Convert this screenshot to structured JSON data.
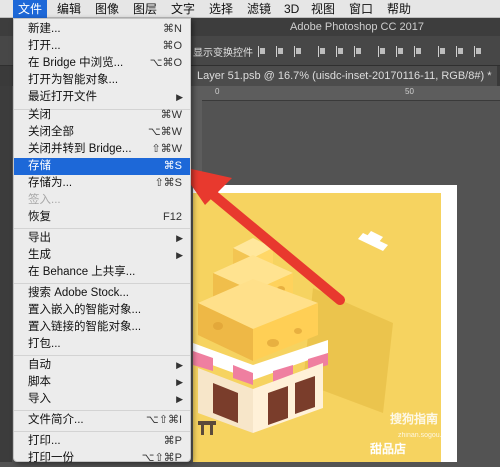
{
  "menubar": {
    "items": [
      "文件",
      "编辑",
      "图像",
      "图层",
      "文字",
      "选择",
      "滤镜",
      "3D",
      "视图",
      "窗口",
      "帮助"
    ]
  },
  "app": {
    "title": "Adobe Photoshop CC 2017"
  },
  "options_bar": {
    "label": "显示变换控件"
  },
  "document_tab": {
    "title": "Layer 51.psb @ 16.7% (uisdc-inset-20170116-11, RGB/8#) *"
  },
  "ruler": {
    "ticks": [
      "0",
      "50"
    ]
  },
  "file_menu": {
    "items": [
      {
        "label": "新建...",
        "shortcut": "⌘N"
      },
      {
        "label": "打开...",
        "shortcut": "⌘O"
      },
      {
        "label": "在 Bridge 中浏览...",
        "shortcut": "⌥⌘O"
      },
      {
        "label": "打开为智能对象..."
      },
      {
        "label": "最近打开文件",
        "submenu": true
      },
      {
        "label": "关闭",
        "shortcut": "⌘W"
      },
      {
        "label": "关闭全部",
        "shortcut": "⌥⌘W"
      },
      {
        "label": "关闭并转到 Bridge...",
        "shortcut": "⇧⌘W"
      },
      {
        "label": "存储",
        "shortcut": "⌘S",
        "highlighted": true
      },
      {
        "label": "存储为...",
        "shortcut": "⇧⌘S"
      },
      {
        "label": "签入...",
        "disabled": true
      },
      {
        "label": "恢复",
        "shortcut": "F12"
      },
      {
        "label": "导出",
        "submenu": true
      },
      {
        "label": "生成",
        "submenu": true
      },
      {
        "label": "在 Behance 上共享..."
      },
      {
        "label": "搜索 Adobe Stock..."
      },
      {
        "label": "置入嵌入的智能对象..."
      },
      {
        "label": "置入链接的智能对象..."
      },
      {
        "label": "打包..."
      },
      {
        "label": "自动",
        "submenu": true
      },
      {
        "label": "脚本",
        "submenu": true
      },
      {
        "label": "导入",
        "submenu": true
      },
      {
        "label": "文件简介...",
        "shortcut": "⌥⇧⌘I"
      },
      {
        "label": "打印...",
        "shortcut": "⌘P"
      },
      {
        "label": "打印一份",
        "shortcut": "⌥⇧⌘P"
      }
    ]
  },
  "canvas": {
    "sign_text": "甜品店"
  },
  "watermark": {
    "brand": "搜狗指南",
    "url": "zhinan.sogou.com"
  },
  "colors": {
    "highlight": "#1d68d8",
    "arrow": "#e8392e",
    "artboard": "#f6d360"
  }
}
